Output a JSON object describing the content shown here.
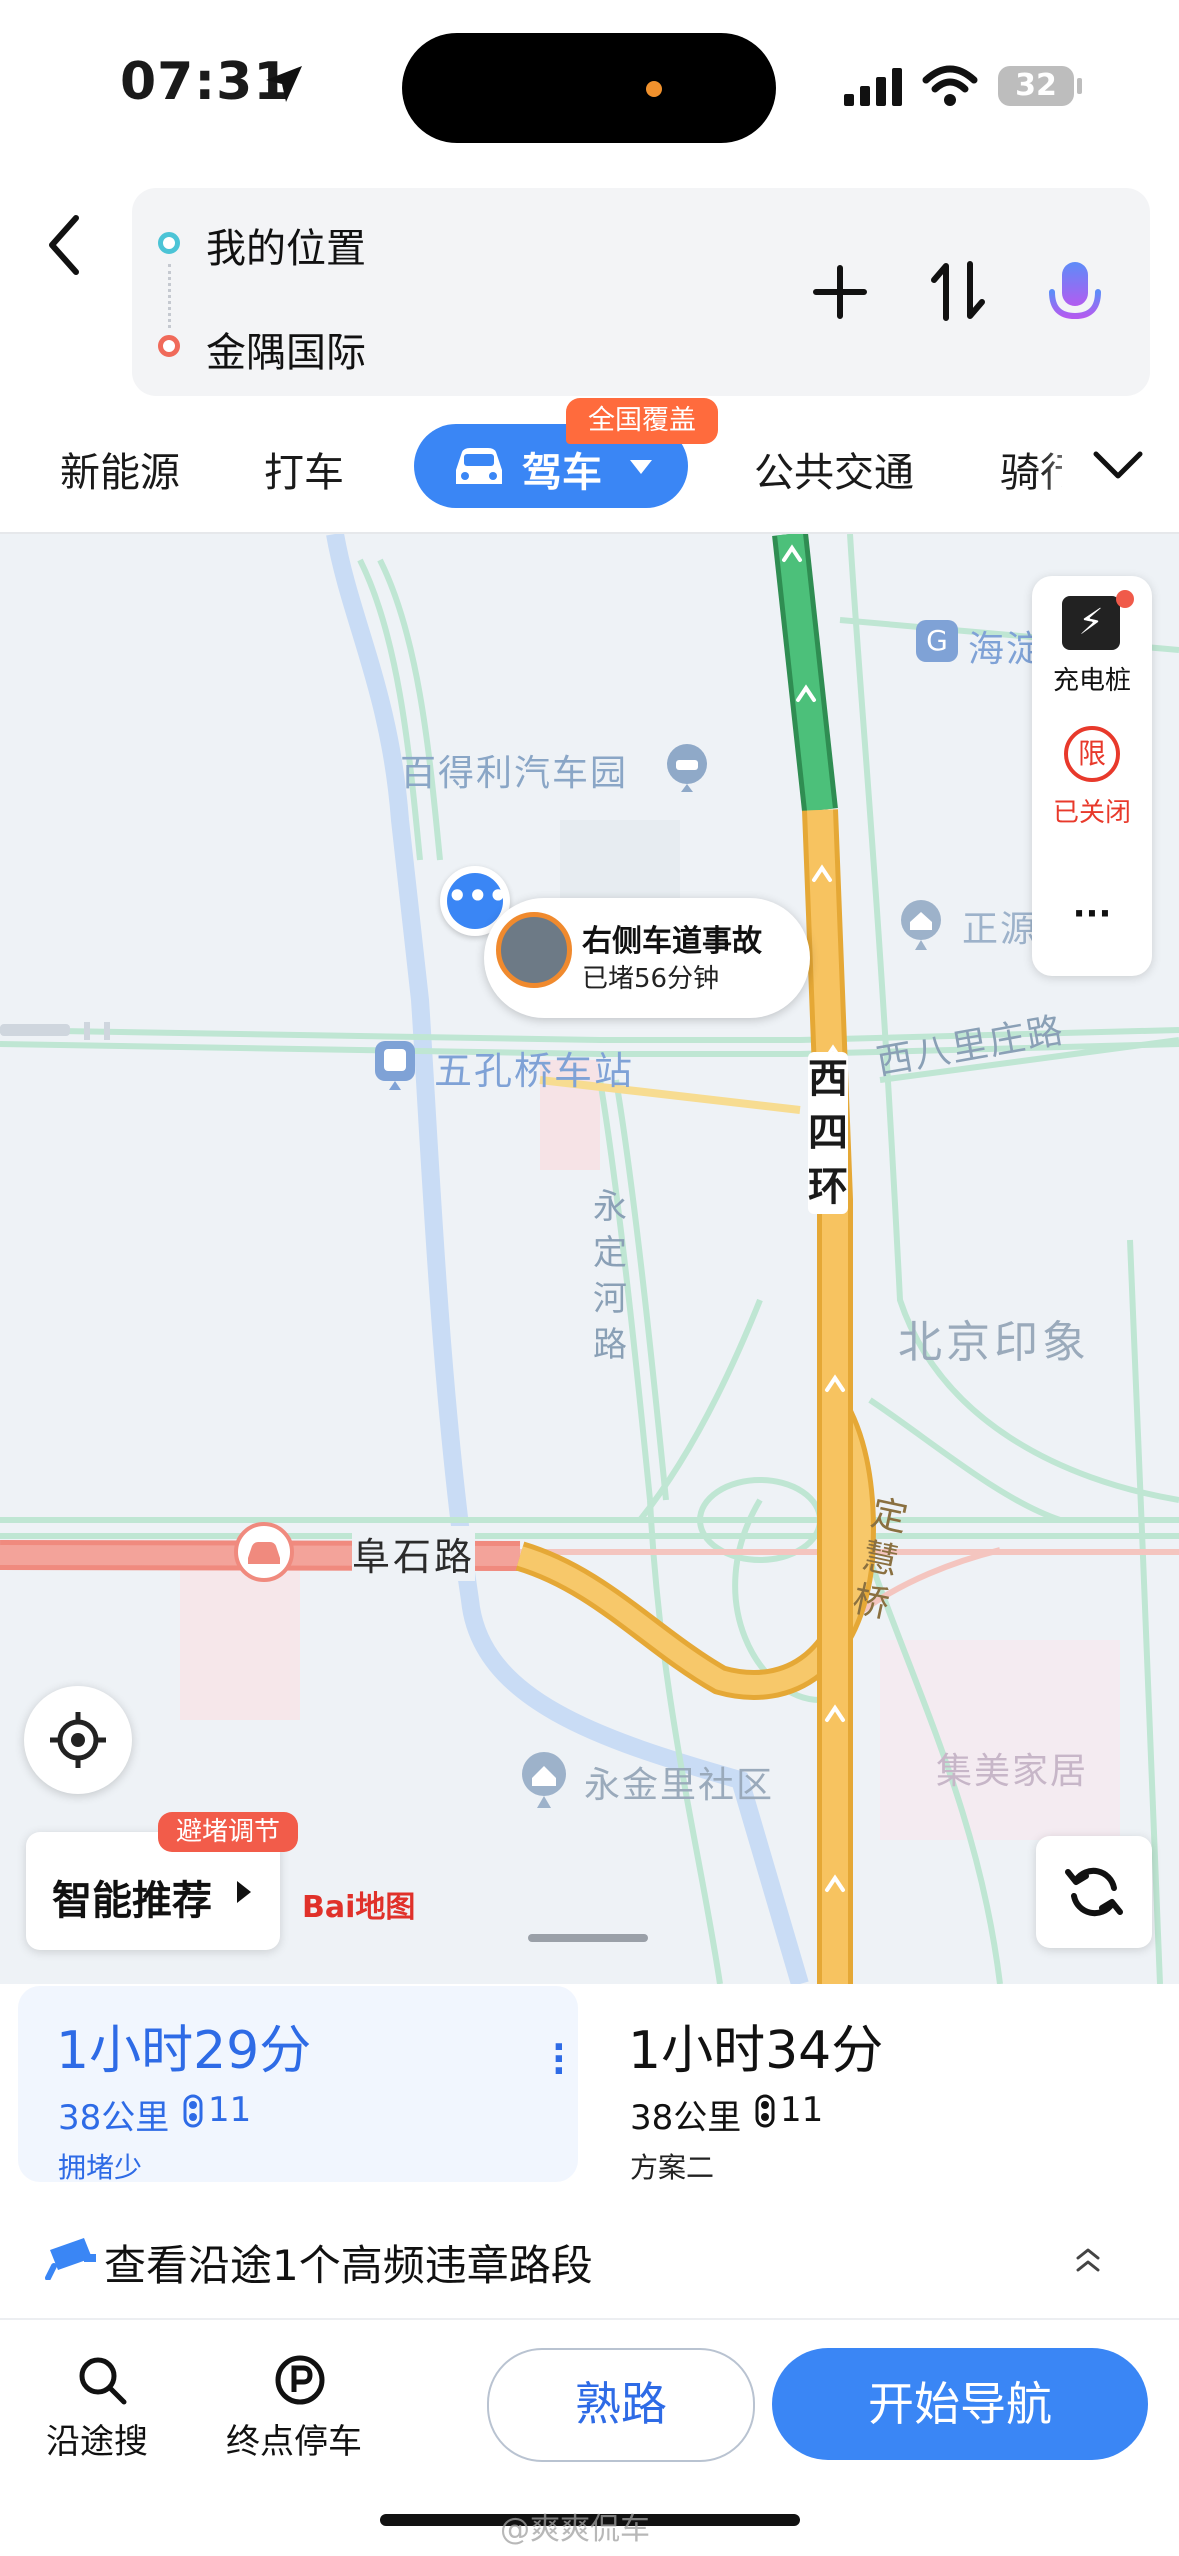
{
  "status_bar": {
    "time": "07:31",
    "battery": "32"
  },
  "route": {
    "origin": "我的位置",
    "destination": "金隅国际"
  },
  "tabs": {
    "new_energy": "新能源",
    "taxi": "打车",
    "drive": "驾车",
    "drive_badge": "全国覆盖",
    "transit": "公共交通",
    "bike": "骑行"
  },
  "map": {
    "labels": {
      "car_park": "百得利汽车园",
      "bus_station": "五孔桥车站",
      "haidian": "海淀",
      "zhengyuan": "正源",
      "xisihuan": "西四环",
      "xibalizhuang": "西八里庄路",
      "yongding": "永定河路",
      "beijing_yinxiang": "北京印象",
      "fushi_road": "阜石路",
      "dinghui_bridge": "定慧桥",
      "yongjinli": "永金里社区",
      "jimei": "集美家居"
    },
    "incident": {
      "title": "右侧车道事故",
      "subtitle": "已堵56分钟"
    },
    "side_panel": {
      "charging": "充电桩",
      "restriction": "已关闭",
      "restriction_icon": "限"
    },
    "smart_recommend": "智能推荐",
    "jam_badge": "避堵调节",
    "logo": "Bai地图"
  },
  "plans": [
    {
      "time": "1小时29分",
      "distance": "38公里",
      "lights": "11",
      "tag": "拥堵少"
    },
    {
      "time": "1小时34分",
      "distance": "38公里",
      "lights": "11",
      "tag": "方案二"
    }
  ],
  "violation_notice": "查看沿途1个高频违章路段",
  "bottom": {
    "search_along": "沿途搜",
    "parking": "终点停车",
    "familiar": "熟路",
    "start_nav": "开始导航"
  },
  "watermark": "@爽爽侃车",
  "colors": {
    "accent": "#3a86f5",
    "traffic_smooth": "#3bb36b",
    "traffic_slow": "#f5b93a",
    "traffic_jam": "#f08a7e",
    "badge_orange": "#ff6b3d"
  }
}
